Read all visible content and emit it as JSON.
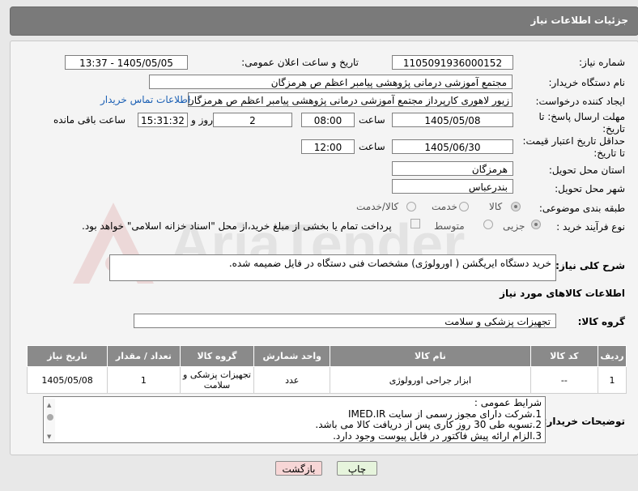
{
  "header": {
    "title": "جزئیات اطلاعات نیاز"
  },
  "form": {
    "need_number_label": "شماره نیاز:",
    "need_number": "1105091936000152",
    "announce_label": "تاریخ و ساعت اعلان عمومی:",
    "announce_value": "1405/05/05 - 13:37",
    "buyer_org_label": "نام دستگاه خریدار:",
    "buyer_org": "مجتمع آموزشی درمانی پژوهشی پیامبر اعظم ص  هرمزگان",
    "requester_label": "ایجاد کننده درخواست:",
    "requester": "زیور لاهوری کارپرداز مجتمع آموزشی درمانی پژوهشی پیامبر اعظم ص  هرمزگان",
    "contact_link": "اطلاعات تماس خریدار",
    "deadline_label_1": "مهلت ارسال پاسخ: تا",
    "deadline_label_2": "تاریخ:",
    "deadline_date": "1405/05/08",
    "time_label": "ساعت",
    "deadline_time": "08:00",
    "days": "2",
    "days_label": "روز و",
    "remaining_time": "15:31:32",
    "remaining_label": "ساعت باقی مانده",
    "min_price_label_1": "حداقل تاریخ اعتبار قیمت:",
    "min_price_label_2": "تا تاریخ:",
    "price_date": "1405/06/30",
    "price_time": "12:00",
    "province_label": "استان محل تحویل:",
    "province": "هرمزگان",
    "city_label": "شهر محل تحویل:",
    "city": "بندرعباس",
    "category_label": "طبقه بندی موضوعی:",
    "category_options": [
      "کالا",
      "خدمت",
      "کالا/خدمت"
    ],
    "category_selected": "کالا",
    "process_label": "نوع فرآیند خرید :",
    "process_options": [
      "جزیی",
      "متوسط"
    ],
    "payment_note": "پرداخت تمام یا بخشی از مبلغ خرید،از محل \"اسناد خزانه اسلامی\" خواهد بود.",
    "description_label": "شرح کلی نیاز:",
    "description": "خرید دستگاه ایریگشن ( اورولوژی)  مشخصات فنی دستگاه در فایل ضمیمه شده.",
    "goods_info_title": "اطلاعات کالاهای مورد نیاز",
    "goods_group_label": "گروه کالا:",
    "goods_group": "تجهیزات پزشکی و سلامت"
  },
  "table": {
    "headers": [
      "ردیف",
      "کد کالا",
      "نام کالا",
      "واحد شمارش",
      "گروه کالا",
      "تعداد / مقدار",
      "تاریخ نیاز"
    ],
    "rows": [
      [
        "1",
        "--",
        "ابزار جراحی اورولوژی",
        "عدد",
        "تجهیزات پزشکی و سلامت",
        "1",
        "1405/05/08"
      ]
    ]
  },
  "buyer_notes": {
    "label": "توضیحات خریدار:",
    "lines": [
      "شرایط عمومی :",
      "1.شرکت دارای مجوز رسمی از سایت IMED.IR",
      "2.تسویه طی  30 روز کاری پس از دریافت کالا می باشد.",
      "3.الزام ارائه پیش فاکتور در فایل پیوست وجود دارد."
    ]
  },
  "buttons": {
    "print": "چاپ",
    "back": "بازگشت"
  },
  "watermark": {
    "text": "AriaTender.net"
  },
  "colors": {
    "header_bg": "#7a7a7a",
    "link": "#1a5fb4",
    "back_button": "#f7d6d6",
    "print_button": "#e6f4dc"
  }
}
